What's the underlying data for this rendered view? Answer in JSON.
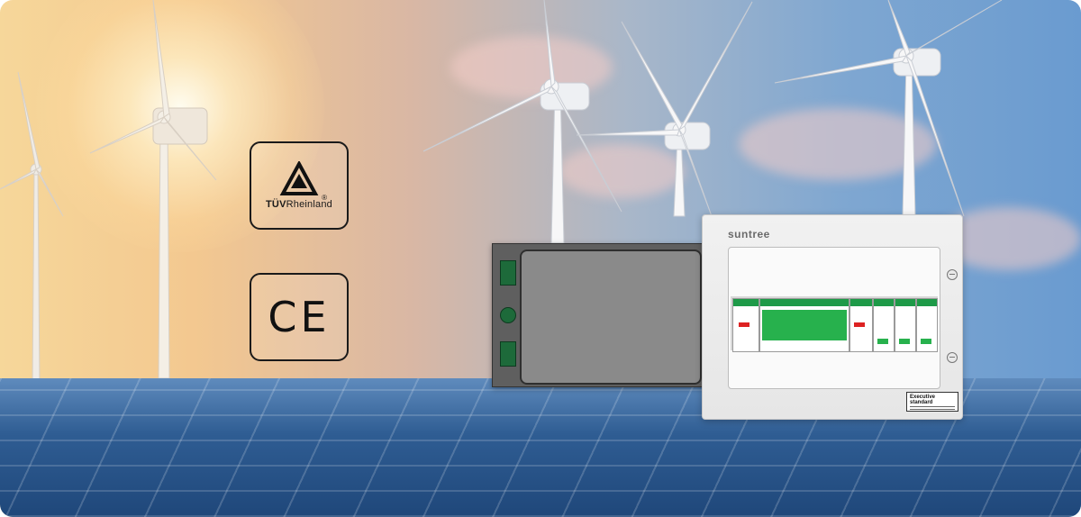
{
  "certifications": [
    {
      "name": "TÜV Rheinland",
      "text_bold": "TÜV",
      "text_light": "Rheinland",
      "registered": "®"
    },
    {
      "name": "CE",
      "text": "CE"
    }
  ],
  "product": {
    "brand": "suntree",
    "label_title": "Executive standard"
  },
  "colors": {
    "sky_warm": "#f3c890",
    "sky_cool": "#6a9bd0",
    "panel_blue": "#2f5d93",
    "breaker_green": "#27b14d",
    "door_gray": "#5f5f5f"
  }
}
